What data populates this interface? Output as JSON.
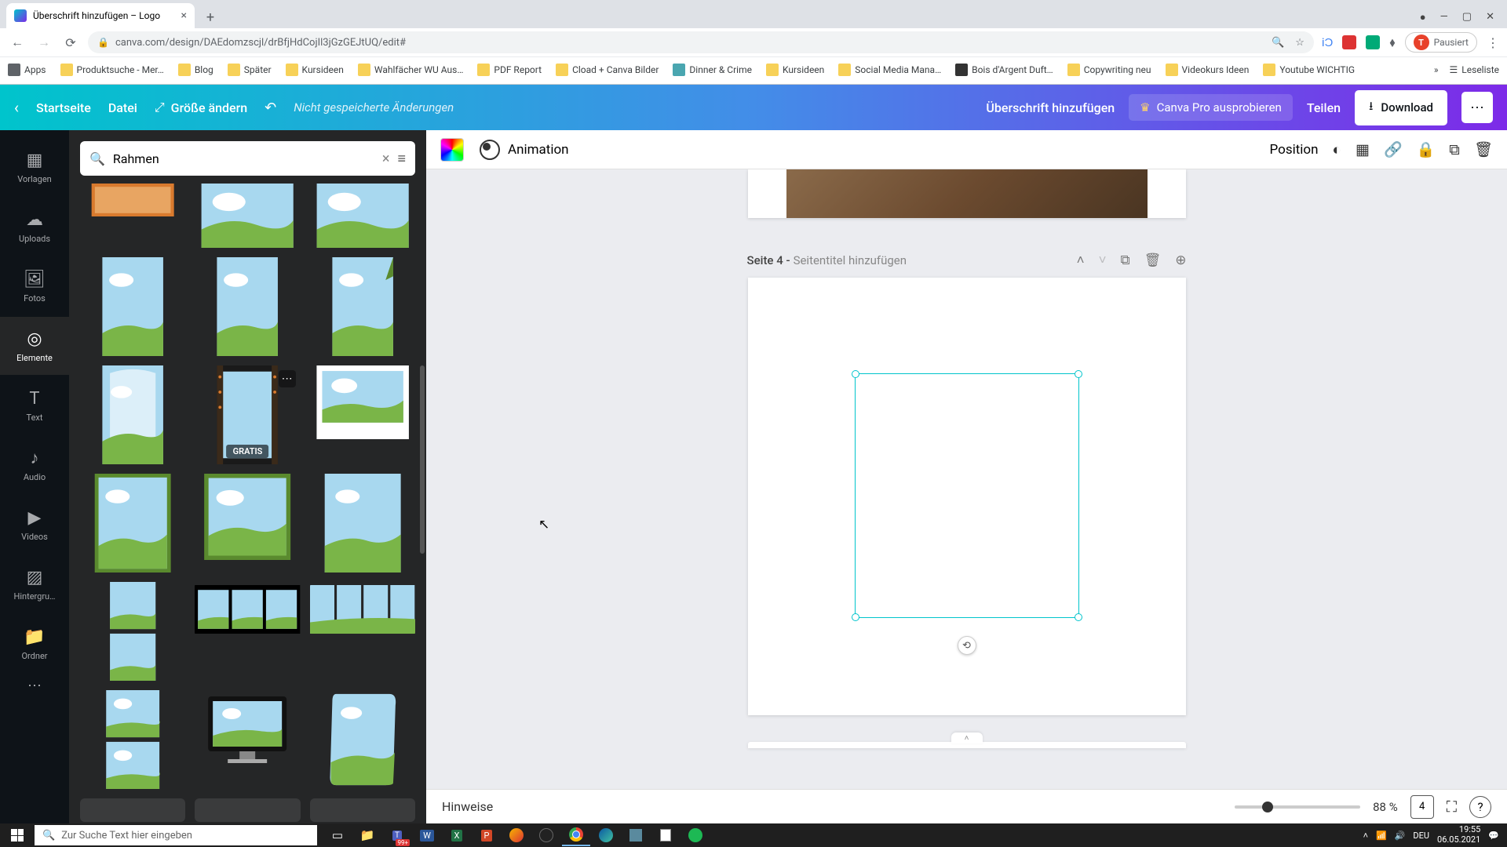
{
  "browser": {
    "tab_title": "Überschrift hinzufügen – Logo",
    "url": "canva.com/design/DAEdomzscjl/drBfjHdCojIl3jGzGEJtUQ/edit#",
    "profile_label": "Pausiert",
    "profile_initial": "T",
    "bookmarks": [
      "Apps",
      "Produktsuche - Mer…",
      "Blog",
      "Später",
      "Kursideen",
      "Wahlfächer WU Aus…",
      "PDF Report",
      "Cload + Canva Bilder",
      "Dinner & Crime",
      "Kursideen",
      "Social Media Mana…",
      "Bois d'Argent Duft…",
      "Copywriting neu",
      "Videokurs Ideen",
      "Youtube WICHTIG"
    ],
    "bookmark_overflow": "Leseliste"
  },
  "header": {
    "home": "Startseite",
    "file": "Datei",
    "resize": "Größe ändern",
    "unsaved": "Nicht gespeicherte Änderungen",
    "design_title": "Überschrift hinzufügen",
    "pro": "Canva Pro ausprobieren",
    "share": "Teilen",
    "download": "Download"
  },
  "rail": {
    "templates": "Vorlagen",
    "uploads": "Uploads",
    "photos": "Fotos",
    "elements": "Elemente",
    "text": "Text",
    "audio": "Audio",
    "videos": "Videos",
    "background": "Hintergru…",
    "folder": "Ordner"
  },
  "panel": {
    "search_value": "Rahmen",
    "gratis_badge": "GRATIS"
  },
  "context": {
    "animation": "Animation",
    "position": "Position"
  },
  "page": {
    "label_prefix": "Seite 4 - ",
    "title_placeholder": "Seitentitel hinzufügen"
  },
  "footer": {
    "notes": "Hinweise",
    "zoom": "88 %",
    "page_count": "4"
  },
  "taskbar": {
    "search_placeholder": "Zur Suche Text hier eingeben",
    "notif_count": "99+",
    "time": "19:55",
    "date": "06.05.2021",
    "lang": "DEU"
  }
}
